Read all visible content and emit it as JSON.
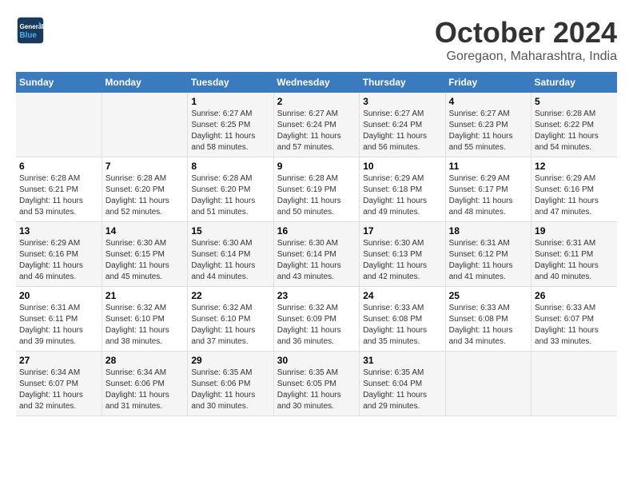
{
  "header": {
    "logo_line1": "General",
    "logo_line2": "Blue",
    "month": "October 2024",
    "location": "Goregaon, Maharashtra, India"
  },
  "weekdays": [
    "Sunday",
    "Monday",
    "Tuesday",
    "Wednesday",
    "Thursday",
    "Friday",
    "Saturday"
  ],
  "weeks": [
    [
      {
        "day": "",
        "sunrise": "",
        "sunset": "",
        "daylight": ""
      },
      {
        "day": "",
        "sunrise": "",
        "sunset": "",
        "daylight": ""
      },
      {
        "day": "1",
        "sunrise": "Sunrise: 6:27 AM",
        "sunset": "Sunset: 6:25 PM",
        "daylight": "Daylight: 11 hours and 58 minutes."
      },
      {
        "day": "2",
        "sunrise": "Sunrise: 6:27 AM",
        "sunset": "Sunset: 6:24 PM",
        "daylight": "Daylight: 11 hours and 57 minutes."
      },
      {
        "day": "3",
        "sunrise": "Sunrise: 6:27 AM",
        "sunset": "Sunset: 6:24 PM",
        "daylight": "Daylight: 11 hours and 56 minutes."
      },
      {
        "day": "4",
        "sunrise": "Sunrise: 6:27 AM",
        "sunset": "Sunset: 6:23 PM",
        "daylight": "Daylight: 11 hours and 55 minutes."
      },
      {
        "day": "5",
        "sunrise": "Sunrise: 6:28 AM",
        "sunset": "Sunset: 6:22 PM",
        "daylight": "Daylight: 11 hours and 54 minutes."
      }
    ],
    [
      {
        "day": "6",
        "sunrise": "Sunrise: 6:28 AM",
        "sunset": "Sunset: 6:21 PM",
        "daylight": "Daylight: 11 hours and 53 minutes."
      },
      {
        "day": "7",
        "sunrise": "Sunrise: 6:28 AM",
        "sunset": "Sunset: 6:20 PM",
        "daylight": "Daylight: 11 hours and 52 minutes."
      },
      {
        "day": "8",
        "sunrise": "Sunrise: 6:28 AM",
        "sunset": "Sunset: 6:20 PM",
        "daylight": "Daylight: 11 hours and 51 minutes."
      },
      {
        "day": "9",
        "sunrise": "Sunrise: 6:28 AM",
        "sunset": "Sunset: 6:19 PM",
        "daylight": "Daylight: 11 hours and 50 minutes."
      },
      {
        "day": "10",
        "sunrise": "Sunrise: 6:29 AM",
        "sunset": "Sunset: 6:18 PM",
        "daylight": "Daylight: 11 hours and 49 minutes."
      },
      {
        "day": "11",
        "sunrise": "Sunrise: 6:29 AM",
        "sunset": "Sunset: 6:17 PM",
        "daylight": "Daylight: 11 hours and 48 minutes."
      },
      {
        "day": "12",
        "sunrise": "Sunrise: 6:29 AM",
        "sunset": "Sunset: 6:16 PM",
        "daylight": "Daylight: 11 hours and 47 minutes."
      }
    ],
    [
      {
        "day": "13",
        "sunrise": "Sunrise: 6:29 AM",
        "sunset": "Sunset: 6:16 PM",
        "daylight": "Daylight: 11 hours and 46 minutes."
      },
      {
        "day": "14",
        "sunrise": "Sunrise: 6:30 AM",
        "sunset": "Sunset: 6:15 PM",
        "daylight": "Daylight: 11 hours and 45 minutes."
      },
      {
        "day": "15",
        "sunrise": "Sunrise: 6:30 AM",
        "sunset": "Sunset: 6:14 PM",
        "daylight": "Daylight: 11 hours and 44 minutes."
      },
      {
        "day": "16",
        "sunrise": "Sunrise: 6:30 AM",
        "sunset": "Sunset: 6:14 PM",
        "daylight": "Daylight: 11 hours and 43 minutes."
      },
      {
        "day": "17",
        "sunrise": "Sunrise: 6:30 AM",
        "sunset": "Sunset: 6:13 PM",
        "daylight": "Daylight: 11 hours and 42 minutes."
      },
      {
        "day": "18",
        "sunrise": "Sunrise: 6:31 AM",
        "sunset": "Sunset: 6:12 PM",
        "daylight": "Daylight: 11 hours and 41 minutes."
      },
      {
        "day": "19",
        "sunrise": "Sunrise: 6:31 AM",
        "sunset": "Sunset: 6:11 PM",
        "daylight": "Daylight: 11 hours and 40 minutes."
      }
    ],
    [
      {
        "day": "20",
        "sunrise": "Sunrise: 6:31 AM",
        "sunset": "Sunset: 6:11 PM",
        "daylight": "Daylight: 11 hours and 39 minutes."
      },
      {
        "day": "21",
        "sunrise": "Sunrise: 6:32 AM",
        "sunset": "Sunset: 6:10 PM",
        "daylight": "Daylight: 11 hours and 38 minutes."
      },
      {
        "day": "22",
        "sunrise": "Sunrise: 6:32 AM",
        "sunset": "Sunset: 6:10 PM",
        "daylight": "Daylight: 11 hours and 37 minutes."
      },
      {
        "day": "23",
        "sunrise": "Sunrise: 6:32 AM",
        "sunset": "Sunset: 6:09 PM",
        "daylight": "Daylight: 11 hours and 36 minutes."
      },
      {
        "day": "24",
        "sunrise": "Sunrise: 6:33 AM",
        "sunset": "Sunset: 6:08 PM",
        "daylight": "Daylight: 11 hours and 35 minutes."
      },
      {
        "day": "25",
        "sunrise": "Sunrise: 6:33 AM",
        "sunset": "Sunset: 6:08 PM",
        "daylight": "Daylight: 11 hours and 34 minutes."
      },
      {
        "day": "26",
        "sunrise": "Sunrise: 6:33 AM",
        "sunset": "Sunset: 6:07 PM",
        "daylight": "Daylight: 11 hours and 33 minutes."
      }
    ],
    [
      {
        "day": "27",
        "sunrise": "Sunrise: 6:34 AM",
        "sunset": "Sunset: 6:07 PM",
        "daylight": "Daylight: 11 hours and 32 minutes."
      },
      {
        "day": "28",
        "sunrise": "Sunrise: 6:34 AM",
        "sunset": "Sunset: 6:06 PM",
        "daylight": "Daylight: 11 hours and 31 minutes."
      },
      {
        "day": "29",
        "sunrise": "Sunrise: 6:35 AM",
        "sunset": "Sunset: 6:06 PM",
        "daylight": "Daylight: 11 hours and 30 minutes."
      },
      {
        "day": "30",
        "sunrise": "Sunrise: 6:35 AM",
        "sunset": "Sunset: 6:05 PM",
        "daylight": "Daylight: 11 hours and 30 minutes."
      },
      {
        "day": "31",
        "sunrise": "Sunrise: 6:35 AM",
        "sunset": "Sunset: 6:04 PM",
        "daylight": "Daylight: 11 hours and 29 minutes."
      },
      {
        "day": "",
        "sunrise": "",
        "sunset": "",
        "daylight": ""
      },
      {
        "day": "",
        "sunrise": "",
        "sunset": "",
        "daylight": ""
      }
    ]
  ]
}
